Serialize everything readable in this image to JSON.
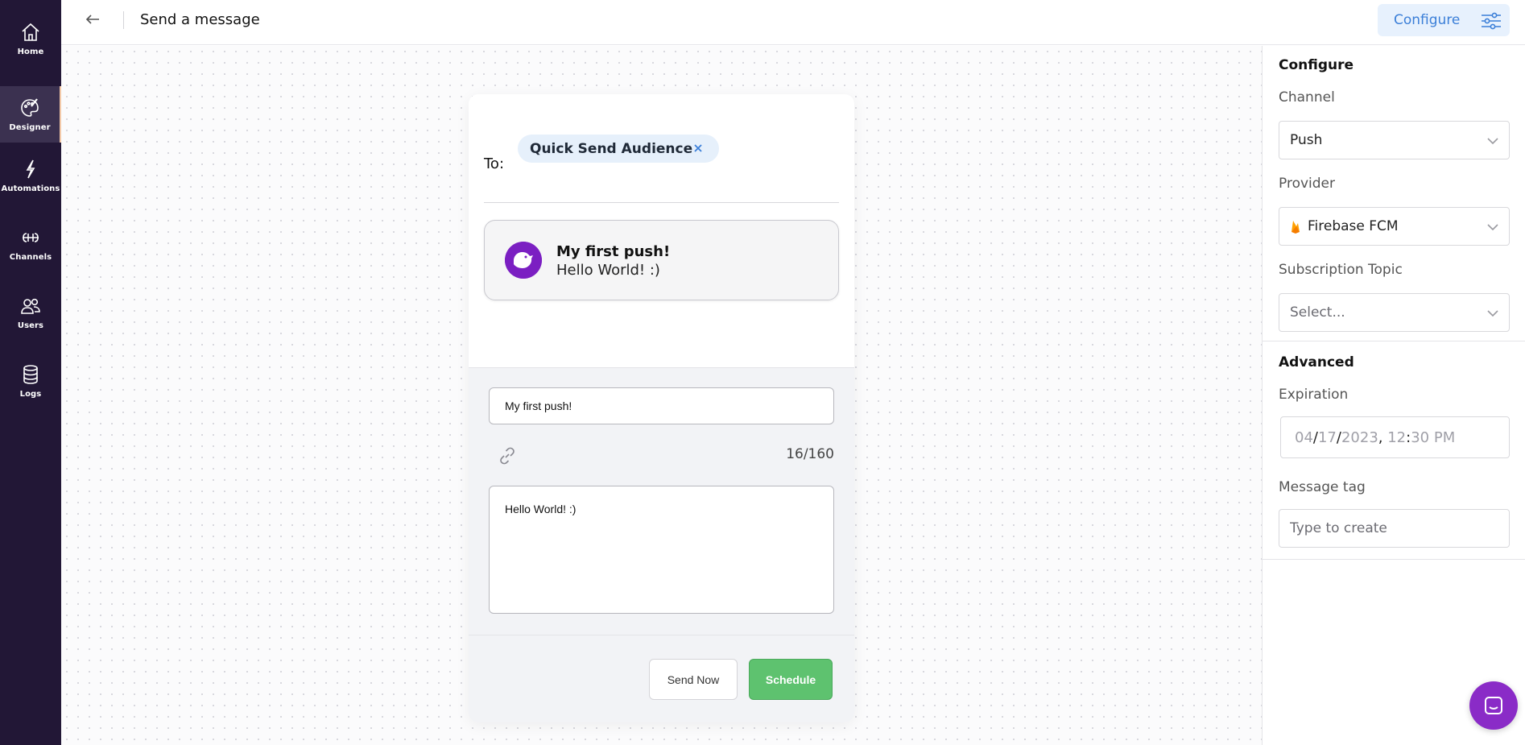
{
  "sidebar": {
    "items": [
      {
        "label": "Home",
        "icon": "home-icon",
        "active": false
      },
      {
        "label": "Designer",
        "icon": "palette-icon",
        "active": true
      },
      {
        "label": "Automations",
        "icon": "lightning-icon",
        "active": false
      },
      {
        "label": "Channels",
        "icon": "channels-icon",
        "active": false
      },
      {
        "label": "Users",
        "icon": "users-icon",
        "active": false
      },
      {
        "label": "Logs",
        "icon": "database-icon",
        "active": false
      }
    ]
  },
  "header": {
    "title": "Send a message",
    "configure_label": "Configure",
    "back_icon": "arrow-left-icon",
    "configure_icon": "sliders-icon"
  },
  "composer": {
    "to_label": "To:",
    "audience_chip": "Quick Send Audience",
    "preview": {
      "title": "My first push!",
      "body": "Hello World! :)"
    },
    "title_input_value": "My first push!",
    "char_count": "16/160",
    "body_input_value": "Hello World! :)",
    "send_now_label": "Send Now",
    "schedule_label": "Schedule"
  },
  "config": {
    "heading": "Configure",
    "channel_label": "Channel",
    "channel_value": "Push",
    "provider_label": "Provider",
    "provider_value": "Firebase FCM",
    "subscription_label": "Subscription Topic",
    "subscription_placeholder": "Select...",
    "advanced_heading": "Advanced",
    "expiration_label": "Expiration",
    "expiration": {
      "month": "04",
      "day": "17",
      "year": "2023",
      "hour": "12",
      "minute": "30",
      "ampm": "PM"
    },
    "message_tag_label": "Message tag",
    "message_tag_placeholder": "Type to create"
  },
  "colors": {
    "sidebar_bg": "#221736",
    "accent_blue": "#3b7fd8",
    "schedule_green": "#5ec26f",
    "brand_purple": "#7b1fc2"
  }
}
